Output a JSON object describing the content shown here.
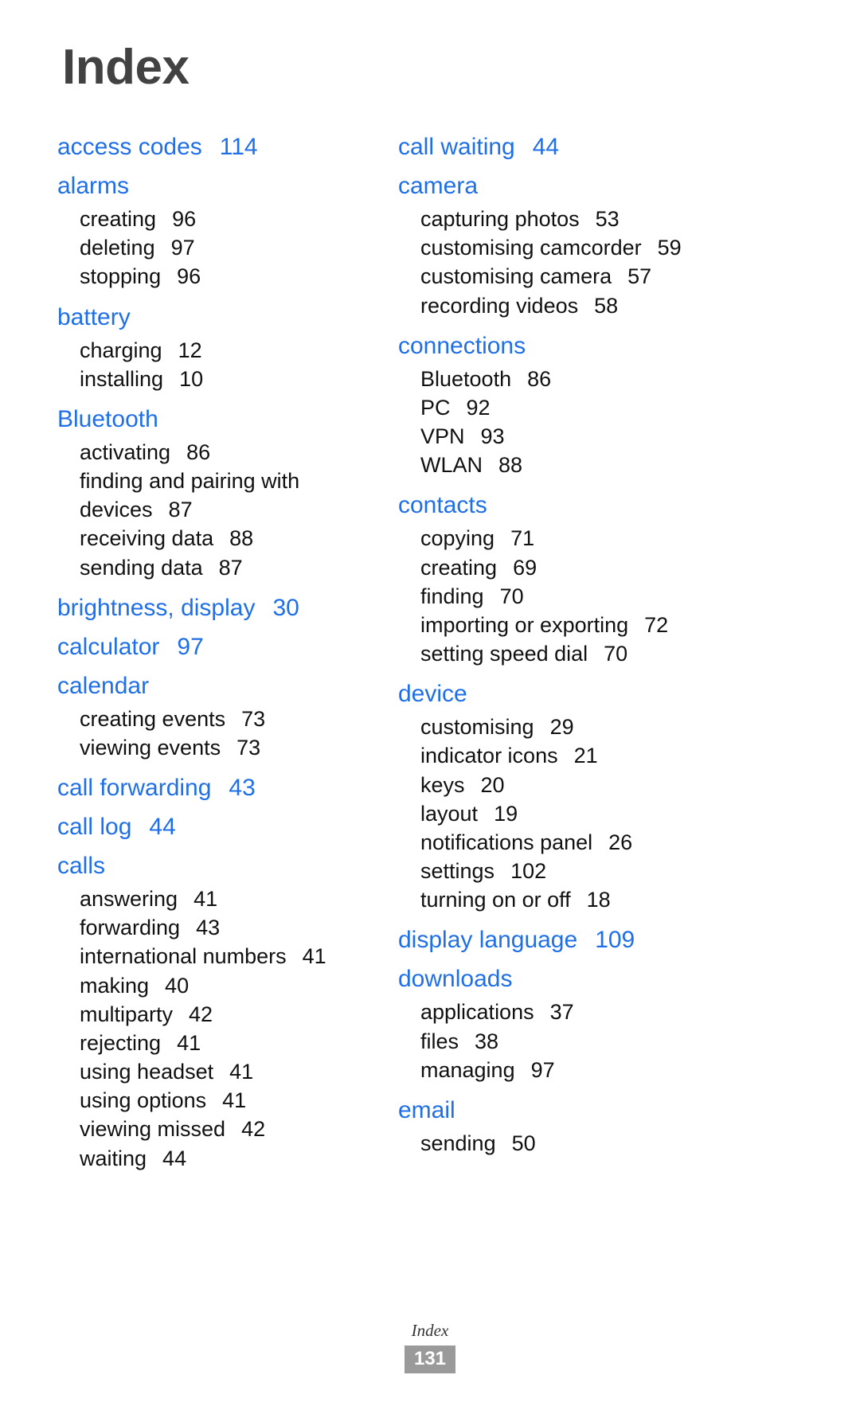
{
  "document": {
    "title": "Index",
    "accent_color": "#1f6fe8",
    "title_color": "#424242",
    "body_color": "#111111"
  },
  "footer": {
    "label": "Index",
    "page_number": "131",
    "badge_color": "#9a9a9a"
  },
  "columns": {
    "left": [
      {
        "head": "access codes",
        "page": "114",
        "items": []
      },
      {
        "head": "alarms",
        "page": "",
        "items": [
          {
            "label": "creating",
            "page": "96"
          },
          {
            "label": "deleting",
            "page": "97"
          },
          {
            "label": "stopping",
            "page": "96"
          }
        ]
      },
      {
        "head": "battery",
        "page": "",
        "items": [
          {
            "label": "charging",
            "page": "12"
          },
          {
            "label": "installing",
            "page": "10"
          }
        ]
      },
      {
        "head": "Bluetooth",
        "page": "",
        "items": [
          {
            "label": "activating",
            "page": "86"
          },
          {
            "label": "finding and pairing with devices",
            "page": "87",
            "wrap": true
          },
          {
            "label": "receiving data",
            "page": "88"
          },
          {
            "label": "sending data",
            "page": "87"
          }
        ]
      },
      {
        "head": "brightness, display",
        "page": "30",
        "items": []
      },
      {
        "head": "calculator",
        "page": "97",
        "items": []
      },
      {
        "head": "calendar",
        "page": "",
        "items": [
          {
            "label": "creating events",
            "page": "73"
          },
          {
            "label": "viewing events",
            "page": "73"
          }
        ]
      },
      {
        "head": "call forwarding",
        "page": "43",
        "items": []
      },
      {
        "head": "call log",
        "page": "44",
        "items": []
      },
      {
        "head": "calls",
        "page": "",
        "items": [
          {
            "label": "answering",
            "page": "41"
          },
          {
            "label": "forwarding",
            "page": "43"
          },
          {
            "label": "international numbers",
            "page": "41"
          },
          {
            "label": "making",
            "page": "40"
          },
          {
            "label": "multiparty",
            "page": "42"
          },
          {
            "label": "rejecting",
            "page": "41"
          },
          {
            "label": "using headset",
            "page": "41"
          },
          {
            "label": "using options",
            "page": "41"
          },
          {
            "label": "viewing missed",
            "page": "42"
          },
          {
            "label": "waiting",
            "page": "44"
          }
        ]
      }
    ],
    "right": [
      {
        "head": "call waiting",
        "page": "44",
        "items": []
      },
      {
        "head": "camera",
        "page": "",
        "items": [
          {
            "label": "capturing photos",
            "page": "53"
          },
          {
            "label": "customising camcorder",
            "page": "59"
          },
          {
            "label": "customising camera",
            "page": "57"
          },
          {
            "label": "recording videos",
            "page": "58"
          }
        ]
      },
      {
        "head": "connections",
        "page": "",
        "items": [
          {
            "label": "Bluetooth",
            "page": "86"
          },
          {
            "label": "PC",
            "page": "92"
          },
          {
            "label": "VPN",
            "page": "93"
          },
          {
            "label": "WLAN",
            "page": "88"
          }
        ]
      },
      {
        "head": "contacts",
        "page": "",
        "items": [
          {
            "label": "copying",
            "page": "71"
          },
          {
            "label": "creating",
            "page": "69"
          },
          {
            "label": "finding",
            "page": "70"
          },
          {
            "label": "importing or exporting",
            "page": "72"
          },
          {
            "label": "setting speed dial",
            "page": "70"
          }
        ]
      },
      {
        "head": "device",
        "page": "",
        "items": [
          {
            "label": "customising",
            "page": "29"
          },
          {
            "label": "indicator icons",
            "page": "21"
          },
          {
            "label": "keys",
            "page": "20"
          },
          {
            "label": "layout",
            "page": "19"
          },
          {
            "label": "notifications panel",
            "page": "26"
          },
          {
            "label": "settings",
            "page": "102"
          },
          {
            "label": "turning on or off",
            "page": "18"
          }
        ]
      },
      {
        "head": "display language",
        "page": "109",
        "items": []
      },
      {
        "head": "downloads",
        "page": "",
        "items": [
          {
            "label": "applications",
            "page": "37"
          },
          {
            "label": "files",
            "page": "38"
          },
          {
            "label": "managing",
            "page": "97"
          }
        ]
      },
      {
        "head": "email",
        "page": "",
        "items": [
          {
            "label": "sending",
            "page": "50"
          }
        ]
      }
    ]
  }
}
